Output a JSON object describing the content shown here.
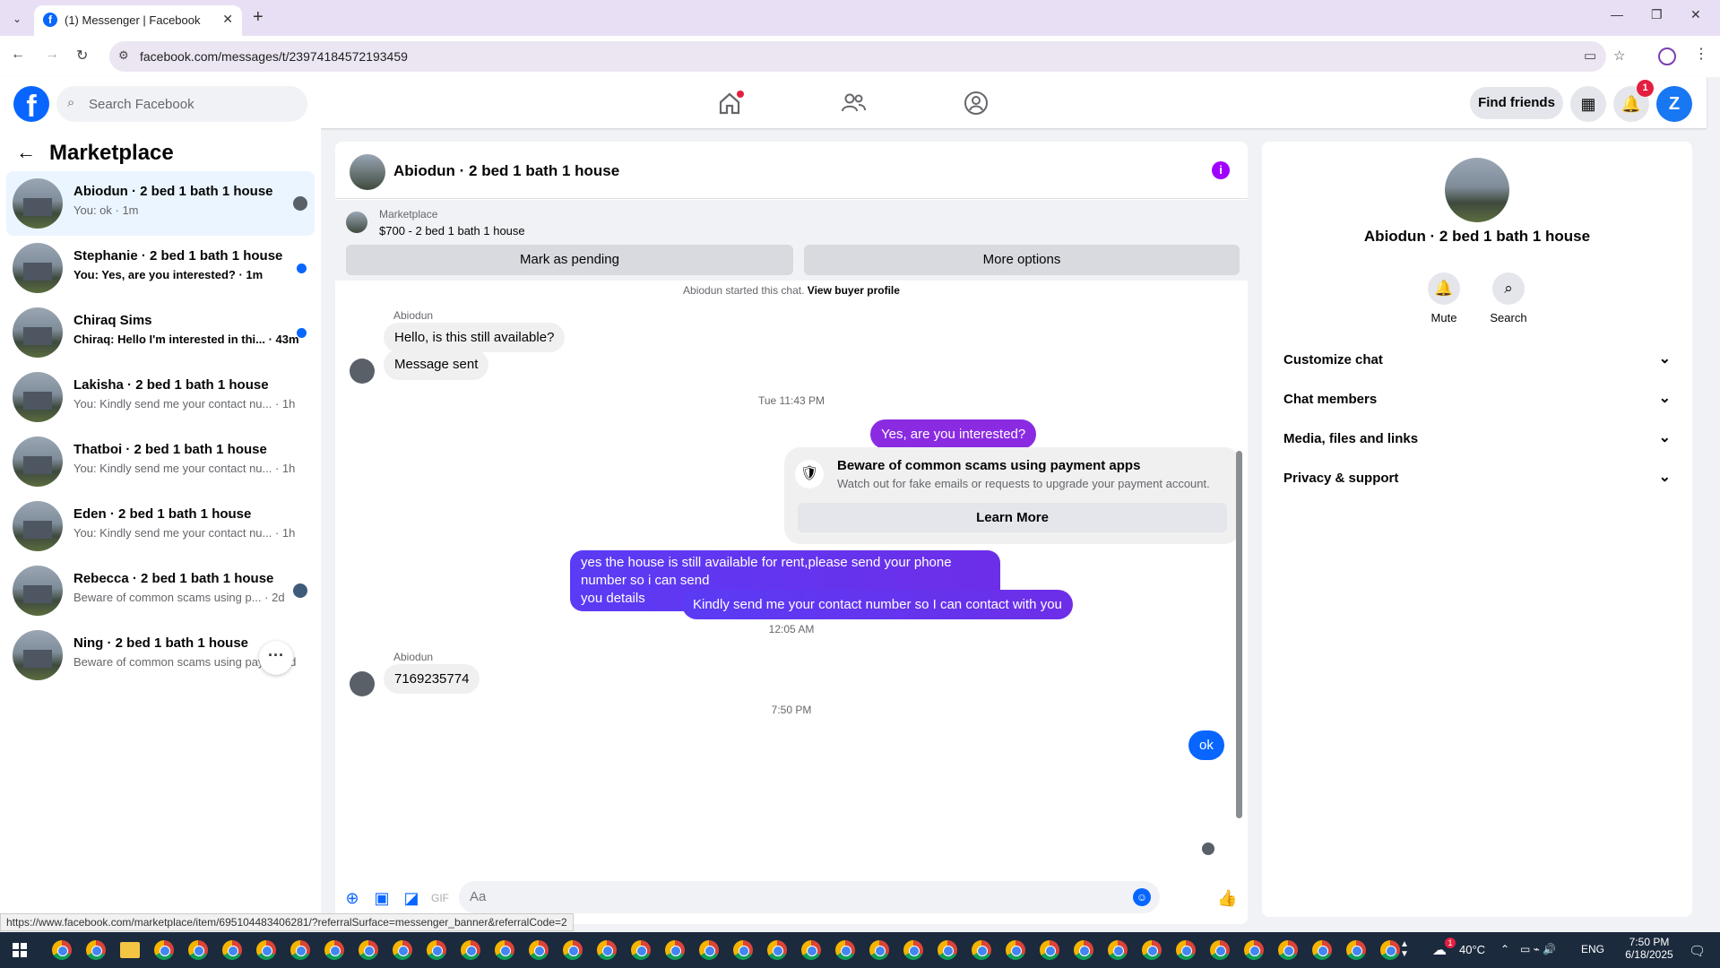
{
  "browser": {
    "tab_title": "(1) Messenger | Facebook",
    "url": "facebook.com/messages/t/23974184572193459",
    "status_url": "https://www.facebook.com/marketplace/item/695104483406281/?referralSurface=messenger_banner&referralCode=2"
  },
  "header": {
    "search_placeholder": "Search Facebook",
    "find_friends": "Find friends",
    "notif_count": "1"
  },
  "sidebar": {
    "title": "Marketplace",
    "items": [
      {
        "name": "Abiodun · 2 bed 1 bath 1 house",
        "snippet": "You: ok · 1m",
        "indicator": "avatar"
      },
      {
        "name": "Stephanie · 2 bed 1 bath 1 house",
        "snippet": "You: Yes, are you interested? · 1m",
        "indicator": "unread"
      },
      {
        "name": "Chiraq Sims",
        "snippet": "Chiraq: Hello I'm interested in thi... · 43m",
        "indicator": "unread"
      },
      {
        "name": "Lakisha · 2 bed 1 bath 1 house",
        "snippet": "You: Kindly send me your contact nu... · 1h",
        "indicator": "none"
      },
      {
        "name": "Thatboi · 2 bed 1 bath 1 house",
        "snippet": "You: Kindly send me your contact nu... · 1h",
        "indicator": "none"
      },
      {
        "name": "Eden · 2 bed 1 bath 1 house",
        "snippet": "You: Kindly send me your contact nu... · 1h",
        "indicator": "none"
      },
      {
        "name": "Rebecca · 2 bed 1 bath 1 house",
        "snippet": "Beware of common scams using p... · 2d",
        "indicator": "avatar"
      },
      {
        "name": "Ning · 2 bed 1 bath 1 house",
        "snippet": "Beware of common scams using pay... · 2d",
        "indicator": "more"
      }
    ]
  },
  "chat": {
    "title": "Abiodun · 2 bed 1 bath 1 house",
    "banner_label": "Marketplace",
    "banner_price": "$700 - 2 bed 1 bath 1 house",
    "mark_pending": "Mark as pending",
    "more_options": "More options",
    "system_text": "Abiodun started this chat.",
    "view_buyer": "View buyer profile",
    "sender1": "Abiodun",
    "msg1": "Hello, is this still available?",
    "msg2": "Message sent",
    "ts1": "Tue 11:43 PM",
    "msg3": "Yes, are you interested?",
    "scam_title": "Beware of common scams using payment apps",
    "scam_desc": "Watch out for fake emails or requests to upgrade your payment account.",
    "learn_more": "Learn More",
    "msg4_line1": "yes the house is still available for rent,please send your  phone number so i can send",
    "msg4_line2": "you details",
    "msg5": "Kindly send me your contact number so I can contact with you",
    "ts2": "12:05 AM",
    "sender2": "Abiodun",
    "msg6": "7169235774",
    "ts3": "7:50 PM",
    "msg7": "ok",
    "composer_placeholder": "Aa"
  },
  "info_panel": {
    "name": "Abiodun · 2 bed 1 bath 1 house",
    "mute": "Mute",
    "search": "Search",
    "sections": [
      "Customize chat",
      "Chat members",
      "Media, files and links",
      "Privacy & support"
    ]
  },
  "taskbar": {
    "temp": "40°C",
    "lang": "ENG",
    "time": "7:50 PM",
    "date": "6/18/2025",
    "weather_badge": "1"
  },
  "colors": {
    "fb_blue": "#0866ff",
    "msg_purple": "#6d2ee8",
    "info_purple": "#a000ff"
  }
}
